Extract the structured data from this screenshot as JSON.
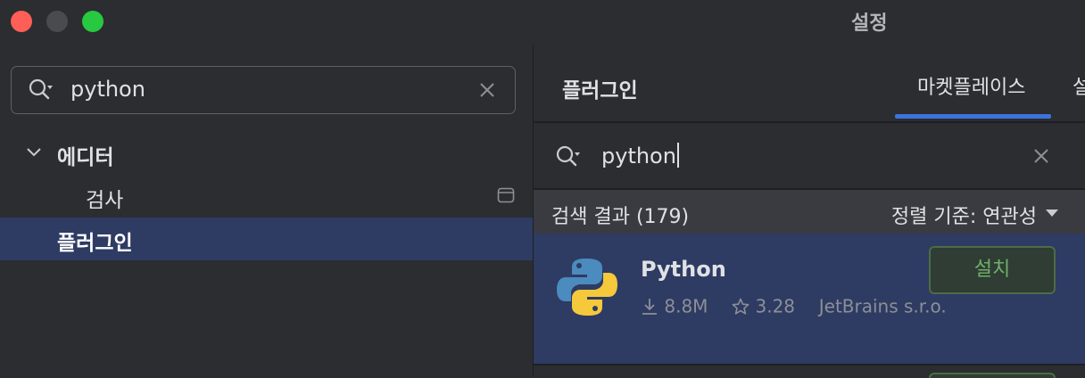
{
  "window": {
    "title": "설정"
  },
  "colors": {
    "selection": "#2e3b63",
    "accent": "#3d74dc",
    "install_green": "#6fb068",
    "background": "#2b2d30"
  },
  "left_panel": {
    "search": {
      "value": "python",
      "icon": "search-icon",
      "clear_icon": "close-icon"
    },
    "tree": [
      {
        "label": "에디터",
        "expanded": true
      },
      {
        "label": "검사",
        "icon": "page-icon"
      },
      {
        "label": "플러그인",
        "selected": true
      }
    ]
  },
  "right_panel": {
    "title": "플러그인",
    "tabs": [
      {
        "label": "마켓플레이스",
        "active": true
      },
      {
        "label": "설치됨"
      }
    ],
    "search": {
      "value": "python",
      "icon": "search-icon",
      "clear_icon": "close-icon"
    },
    "results": {
      "count_label": "검색 결과 (179)",
      "sort_label": "정렬 기준: 연관성"
    },
    "plugins": [
      {
        "name": "Python",
        "downloads": "8.8M",
        "rating": "3.28",
        "vendor": "JetBrains s.r.o.",
        "install_label": "설치",
        "icon": "python-logo-icon"
      }
    ]
  }
}
